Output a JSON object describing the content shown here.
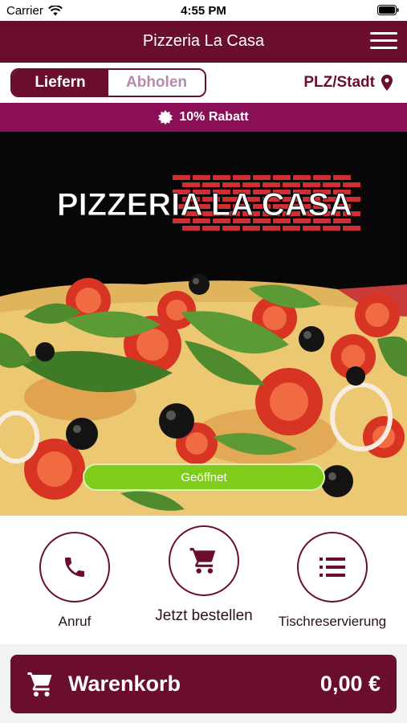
{
  "status_bar": {
    "carrier": "Carrier",
    "time": "4:55 PM"
  },
  "nav": {
    "title": "Pizzeria La Casa",
    "menu_icon": "hamburger-menu-icon"
  },
  "mode": {
    "deliver_label": "Liefern",
    "pickup_label": "Abholen",
    "active": "deliver",
    "location_label": "PLZ/Stadt"
  },
  "promo": {
    "text": "10% Rabatt"
  },
  "hero": {
    "logo_text": "PIZZERIA LA CASA",
    "status_button": "Geöffnet"
  },
  "actions": {
    "call_label": "Anruf",
    "order_label": "Jetzt bestellen",
    "reservation_label": "Tischreservierung"
  },
  "cart": {
    "label": "Warenkorb",
    "total": "0,00 €"
  },
  "colors": {
    "brand": "#6a0e2b",
    "promo": "#8a0f57",
    "open": "#7fcc1d"
  }
}
